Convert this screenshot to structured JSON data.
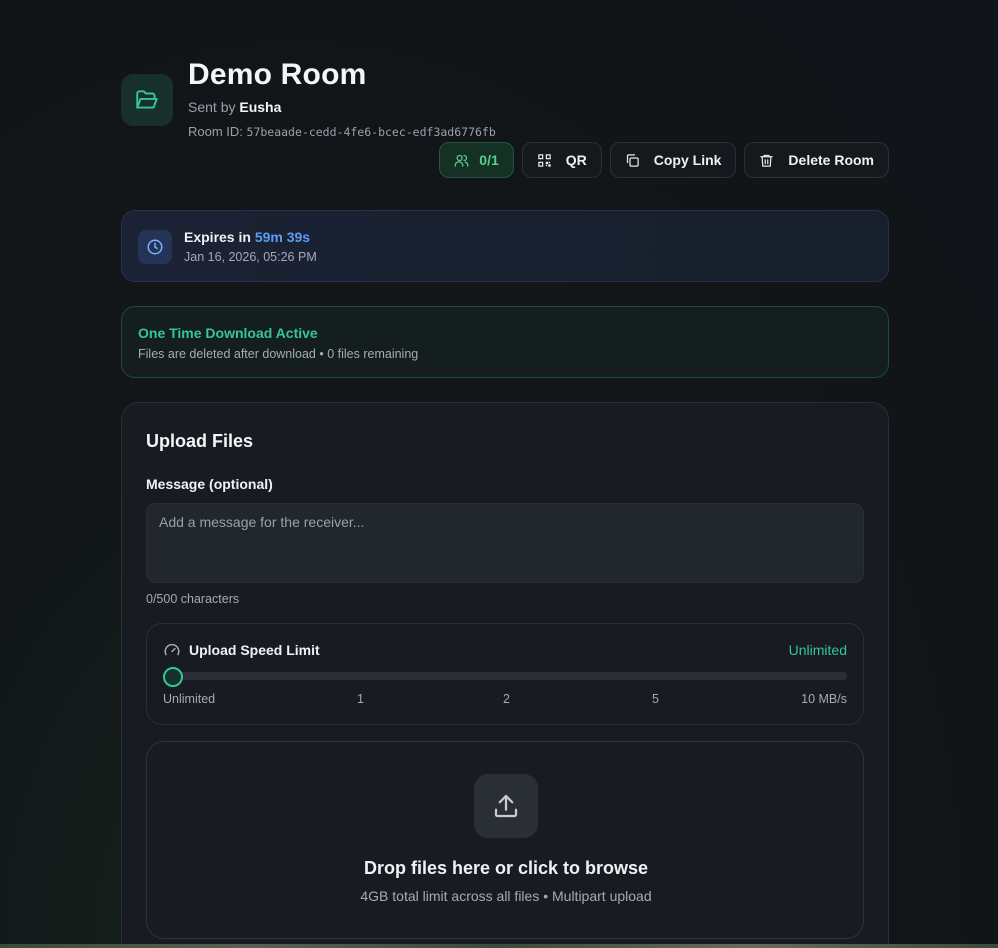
{
  "room": {
    "title": "Demo Room",
    "sent_by_prefix": "Sent by ",
    "sender": "Eusha",
    "room_id_label": "Room ID: ",
    "room_id": "57beaade-cedd-4fe6-bcec-edf3ad6776fb"
  },
  "actions": {
    "users_count": "0/1",
    "qr_label": "QR",
    "copy_link_label": "Copy Link",
    "delete_room_label": "Delete Room"
  },
  "expires": {
    "prefix": "Expires in ",
    "time_left": "59m 39s",
    "date": "Jan 16, 2026, 05:26 PM"
  },
  "one_time": {
    "title": "One Time Download Active",
    "subtitle": "Files are deleted after download • 0 files remaining"
  },
  "upload": {
    "title": "Upload Files",
    "message_label": "Message (optional)",
    "message_placeholder": "Add a message for the receiver...",
    "message_value": "",
    "char_count": "0/500 characters",
    "speed": {
      "title": "Upload Speed Limit",
      "value": "Unlimited",
      "slider_position": 0,
      "ticks": [
        "Unlimited",
        "1",
        "2",
        "5",
        "10 MB/s"
      ]
    },
    "drop": {
      "title": "Drop files here or click to browse",
      "subtitle": "4GB total limit across all files • Multipart upload"
    }
  },
  "colors": {
    "accent_green": "#35c596",
    "accent_blue": "#5b9cf5",
    "users_green": "#57d18b"
  }
}
